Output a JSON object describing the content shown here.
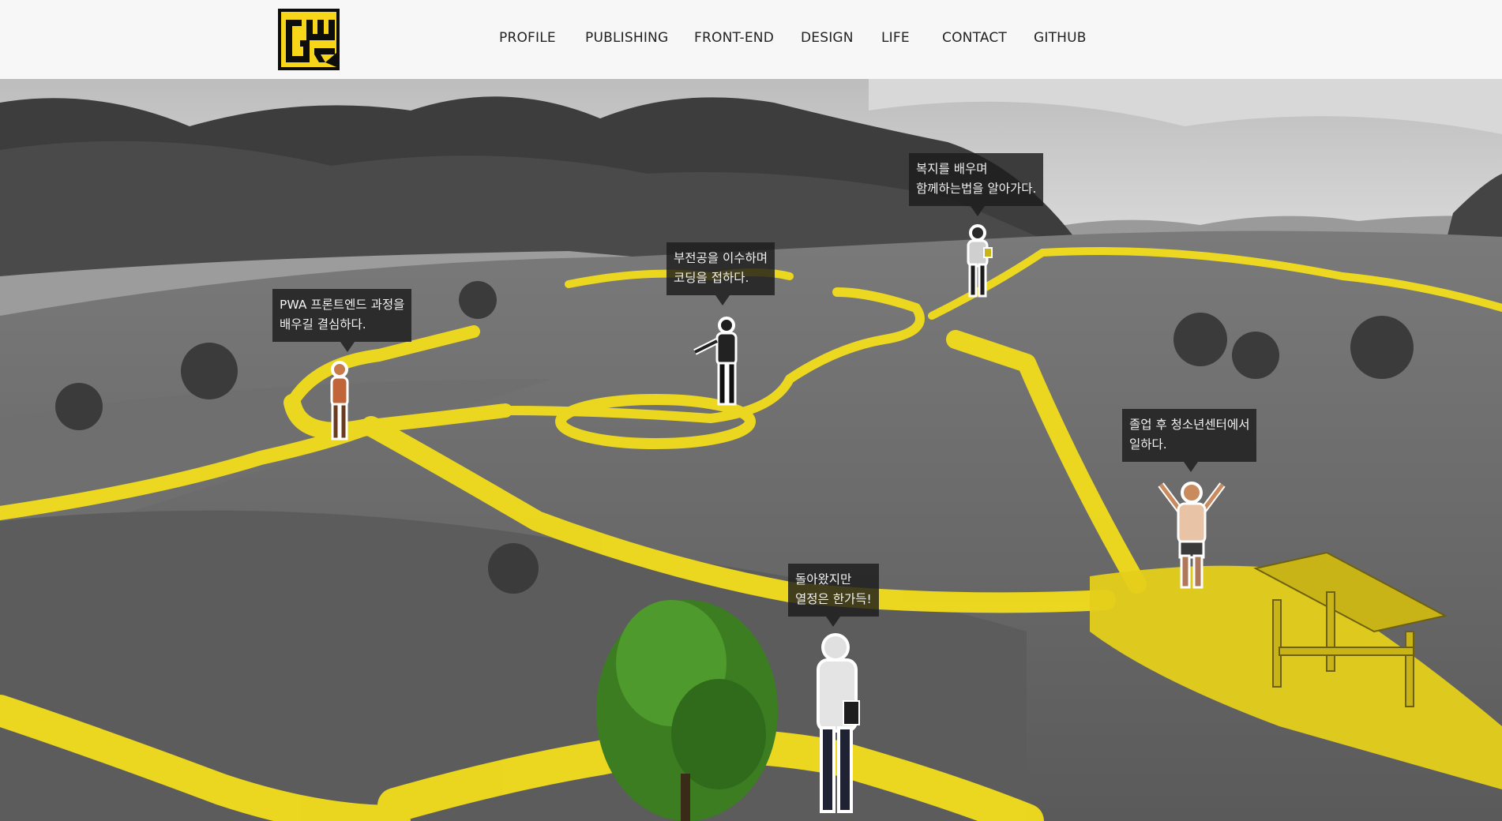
{
  "header": {
    "logo_alt": "GW logo",
    "nav": [
      {
        "label": "PROFILE"
      },
      {
        "label": "PUBLISHING"
      },
      {
        "label": "FRONT-END"
      },
      {
        "label": "DESIGN"
      },
      {
        "label": "LIFE"
      },
      {
        "label": "CONTACT"
      },
      {
        "label": "GITHUB"
      }
    ]
  },
  "story": [
    {
      "lines": [
        "PWA 프론트엔드 과정을",
        "배우길 결심하다."
      ]
    },
    {
      "lines": [
        "부전공을 이수하며",
        "코딩을 접하다."
      ]
    },
    {
      "lines": [
        "복지를 배우며",
        "함께하는법을 알아가다."
      ]
    },
    {
      "lines": [
        "졸업 후 청소년센터에서",
        "일하다."
      ]
    },
    {
      "lines": [
        "돌아왔지만",
        "열정은 한가득!"
      ]
    }
  ],
  "colors": {
    "accent": "#f2dc1c",
    "header_bg": "#f7f7f7",
    "bubble_bg": "#1c1c1c"
  }
}
